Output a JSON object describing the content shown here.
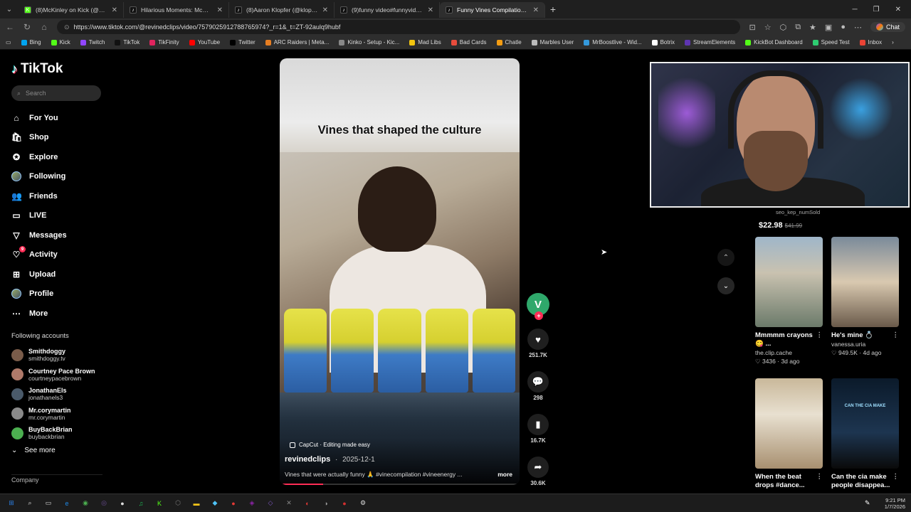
{
  "browser": {
    "tabs": [
      {
        "title": "(8)McKinley on Kick (@mckinley.tv",
        "fav": "K",
        "color": "#53fc18",
        "active": false
      },
      {
        "title": "Hilarious Moments: McChicken Nu",
        "fav": "♪",
        "color": "#111",
        "active": false
      },
      {
        "title": "(8)Aaron Klopfer (@klopptok)'s vid",
        "fav": "♪",
        "color": "#111",
        "active": false
      },
      {
        "title": "(9)funny video#funnyvideos #pra",
        "fav": "♪",
        "color": "#111",
        "active": false
      },
      {
        "title": "Funny Vines Compilation for",
        "fav": "♪",
        "color": "#111",
        "active": true
      }
    ],
    "new_tab": "+",
    "url": "https://www.tiktok.com/@revinedclips/video/7579025912788765974?_r=1&_t=ZT-92aulq9hubf",
    "chat_label": "Chat",
    "bookmarks": [
      {
        "label": "Bing",
        "color": "#00a4ef"
      },
      {
        "label": "Kick",
        "color": "#53fc18"
      },
      {
        "label": "Twitch",
        "color": "#9146ff"
      },
      {
        "label": "TikTok",
        "color": "#111111"
      },
      {
        "label": "TikFinity",
        "color": "#e0245e"
      },
      {
        "label": "YouTube",
        "color": "#ff0000"
      },
      {
        "label": "Twitter",
        "color": "#000000"
      },
      {
        "label": "ARC Raiders | Meta...",
        "color": "#e67e22"
      },
      {
        "label": "Kinko - Setup - Kic...",
        "color": "#888888"
      },
      {
        "label": "Mad Libs",
        "color": "#f1c40f"
      },
      {
        "label": "Bad Cards",
        "color": "#e74c3c"
      },
      {
        "label": "Chatle",
        "color": "#f39c12"
      },
      {
        "label": "Marbles User",
        "color": "#bbbbbb"
      },
      {
        "label": "MrBoostlive - Wid...",
        "color": "#3498db"
      },
      {
        "label": "Botrix",
        "color": "#ffffff"
      },
      {
        "label": "StreamElements",
        "color": "#5e35b1"
      },
      {
        "label": "KickBot Dashboard",
        "color": "#53fc18"
      },
      {
        "label": "Speed Test",
        "color": "#2ecc71"
      },
      {
        "label": "Inbox",
        "color": "#ea4335"
      }
    ]
  },
  "sidebar": {
    "logo": "TikTok",
    "search_placeholder": "Search",
    "nav": [
      {
        "label": "For You",
        "icon": "home-icon",
        "glyph": "⌂"
      },
      {
        "label": "Shop",
        "icon": "shop-icon",
        "glyph": "🛍"
      },
      {
        "label": "Explore",
        "icon": "explore-icon",
        "glyph": "✪"
      },
      {
        "label": "Following",
        "icon": "following-icon",
        "glyph": ""
      },
      {
        "label": "Friends",
        "icon": "friends-icon",
        "glyph": "👥"
      },
      {
        "label": "LIVE",
        "icon": "live-icon",
        "glyph": "▭"
      },
      {
        "label": "Messages",
        "icon": "messages-icon",
        "glyph": "▽"
      },
      {
        "label": "Activity",
        "icon": "activity-icon",
        "glyph": "♡"
      },
      {
        "label": "Upload",
        "icon": "upload-icon",
        "glyph": "⊞"
      },
      {
        "label": "Profile",
        "icon": "profile-icon",
        "glyph": ""
      },
      {
        "label": "More",
        "icon": "more-icon",
        "glyph": "⋯"
      }
    ],
    "following_title": "Following accounts",
    "accounts": [
      {
        "name": "Smithdoggy",
        "handle": "smithdoggy.tv",
        "color": "#7a5c4a"
      },
      {
        "name": "Courtney Pace Brown",
        "handle": "courtneypacebrown",
        "color": "#b07a6a"
      },
      {
        "name": "JonathanEls",
        "handle": "jonathanels3",
        "color": "#4a5a6a"
      },
      {
        "name": "Mr.corymartin",
        "handle": "mr.corymartin",
        "color": "#8a8a8a"
      },
      {
        "name": "BuyBackBrian",
        "handle": "buybackbrian",
        "color": "#4caf50"
      }
    ],
    "see_more": "See more",
    "company": "Company"
  },
  "video": {
    "caption": "Vines that shaped the culture",
    "capcut": "CapCut · Editing made easy",
    "author": "revinedclips",
    "date": "2025-12-1",
    "description": "Vines that were actually funny 🙏 #vinecompilation #vineenergy ...",
    "more": "more",
    "progress": 0.18
  },
  "actions": {
    "likes": "251.7K",
    "comments": "298",
    "saves": "16.7K",
    "shares": "30.6K"
  },
  "product": {
    "seller": "seo_kep_numSold",
    "price": "$22.98",
    "old_price": "$41.99"
  },
  "cards": [
    {
      "title": "Mmmmm crayons 😋 ...",
      "user": "the.clip.cache",
      "stats": "♡ 3436 · 3d ago",
      "bg": "linear-gradient(180deg,#9fb6c9 0%,#c9c2b0 40%,#6b7a6a 100%)"
    },
    {
      "title": "He's mine 💍",
      "user": "vanessa.uria",
      "stats": "♡ 949.5K · 4d ago",
      "bg": "linear-gradient(180deg,#7a8a9a 0%,#d9c9b0 50%,#6a5a4a 100%)"
    },
    {
      "title": "When the beat drops #dance...",
      "user": "",
      "stats": "",
      "bg": "linear-gradient(180deg,#c9b89a 0%,#e8e0d0 40%,#a89070 100%)"
    },
    {
      "title": "Can the cia make people disappea...",
      "user": "",
      "stats": "",
      "bg": "linear-gradient(180deg,#0b1a2a 0%,#1d3550 60%,#0a0a0a 100%)"
    }
  ],
  "card4_overlay": "CAN THE CIA MAKE",
  "taskbar": {
    "icons": [
      "windows-icon",
      "search-icon",
      "taskview-icon",
      "edge-icon",
      "chrome-icon",
      "app-icon",
      "obs-icon",
      "spotify-icon",
      "kick-icon",
      "app2-icon",
      "explorer-icon",
      "app3-icon",
      "app4-icon",
      "app5-icon",
      "app6-icon",
      "app7-icon",
      "app8-icon",
      "app9-icon",
      "app10-icon",
      "settings-icon"
    ],
    "time": "9:21 PM",
    "date": "1/7/2026"
  }
}
